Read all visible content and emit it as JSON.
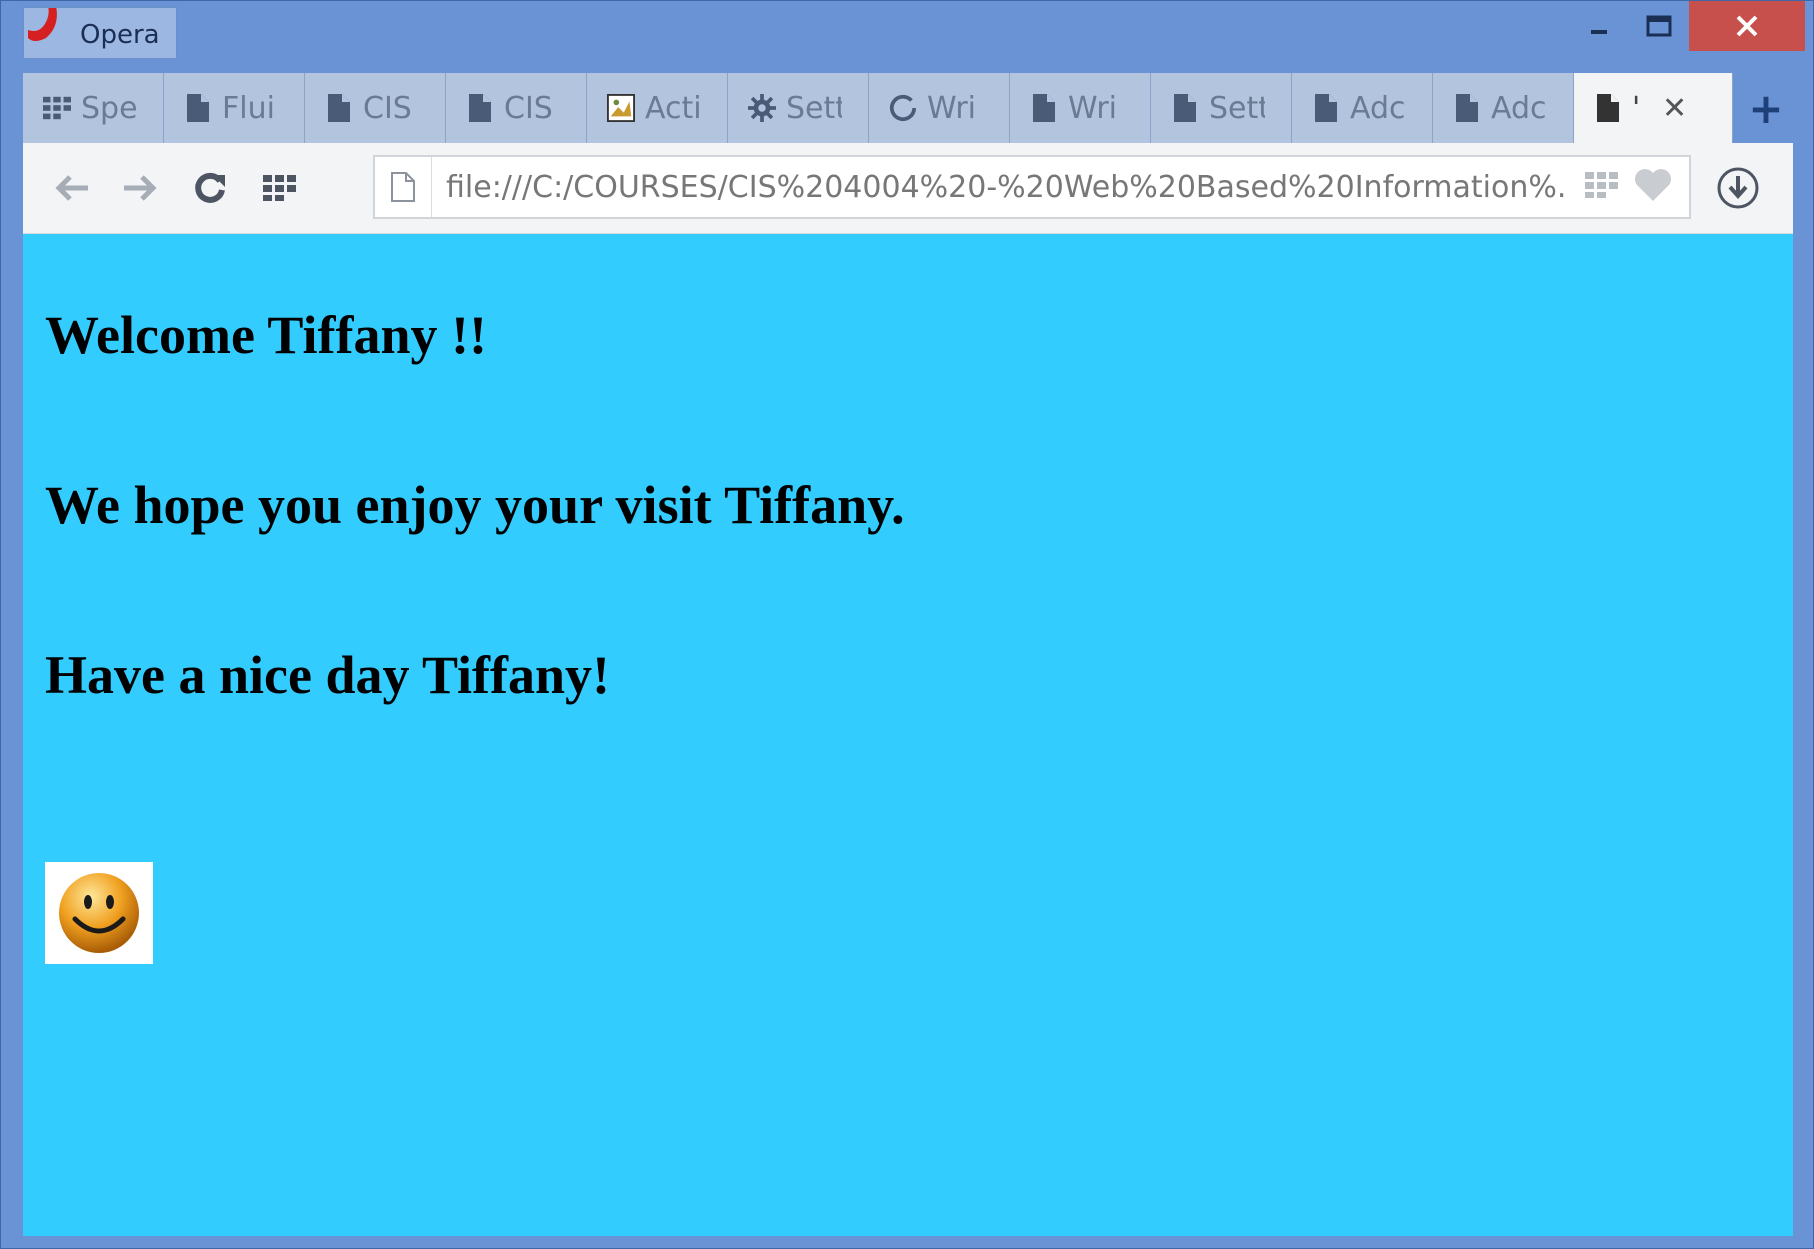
{
  "window": {
    "app_title": "Opera",
    "controls": {
      "minimize": "–",
      "maximize": "☐",
      "close": "✕"
    }
  },
  "tabs": [
    {
      "label": "Spe",
      "icon": "speed-dial-icon"
    },
    {
      "label": "Flui",
      "icon": "page-icon"
    },
    {
      "label": "CIS",
      "icon": "page-icon"
    },
    {
      "label": "CIS",
      "icon": "page-icon"
    },
    {
      "label": "Acti",
      "icon": "image-icon"
    },
    {
      "label": "Sett",
      "icon": "gear-icon"
    },
    {
      "label": "Wri",
      "icon": "loading-icon"
    },
    {
      "label": "Wri",
      "icon": "page-icon"
    },
    {
      "label": "Sett",
      "icon": "page-icon"
    },
    {
      "label": "Adc",
      "icon": "page-icon"
    },
    {
      "label": "Adc",
      "icon": "page-icon"
    },
    {
      "label": "'",
      "icon": "page-icon",
      "active": true,
      "close": "✕"
    }
  ],
  "new_tab_label": "+",
  "toolbar": {
    "url": "file:///C:/COURSES/CIS%204004%20-%20Web%20Based%20Information%."
  },
  "page": {
    "background": "#33ccff",
    "headings": [
      "Welcome Tiffany !!",
      "We hope you enjoy your visit Tiffany.",
      "Have a nice day Tiffany!"
    ],
    "image": "smiley-face-icon"
  }
}
